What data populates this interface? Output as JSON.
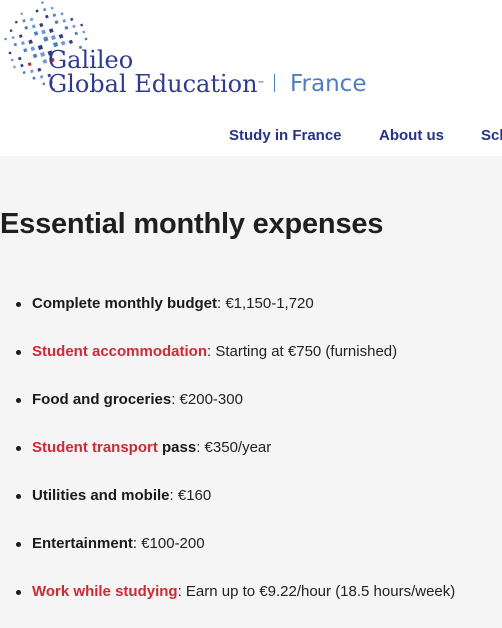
{
  "header": {
    "logo": {
      "line1": "Galileo",
      "line2": "Global Education",
      "tm": "™",
      "country": "France"
    },
    "nav": [
      {
        "label": "Study in France"
      },
      {
        "label": "About us"
      },
      {
        "label": "Sch"
      }
    ]
  },
  "main": {
    "title": "Essential monthly expenses",
    "items": [
      {
        "term": "Complete monthly budget",
        "rest": ": €1,150-1,720"
      },
      {
        "link": "Student accommodation",
        "rest": ": Starting at €750 (furnished)"
      },
      {
        "term": "Food and groceries",
        "rest": ": €200-300"
      },
      {
        "link": "Student transport",
        "term": " pass",
        "rest": ": €350/year"
      },
      {
        "term": "Utilities and mobile",
        "rest": ": €160"
      },
      {
        "term": "Entertainment",
        "rest": ": €100-200"
      },
      {
        "link": "Work while studying",
        "rest": ": Earn up to €9.22/hour (18.5 hours/week)"
      }
    ]
  },
  "colors": {
    "brand_blue": "#2e3b8f",
    "brand_light_blue": "#4f7dc0",
    "link_red": "#cc2a36"
  }
}
